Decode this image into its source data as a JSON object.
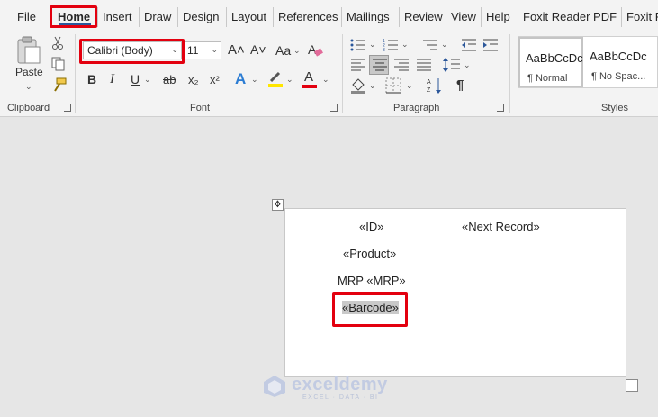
{
  "menu": {
    "tabs": [
      "File",
      "Home",
      "Insert",
      "Draw",
      "Design",
      "Layout",
      "References",
      "Mailings",
      "Review",
      "View",
      "Help",
      "Foxit Reader PDF",
      "Foxit P"
    ],
    "active": "Home"
  },
  "ribbon": {
    "clipboard": {
      "paste_label": "Paste",
      "group_label": "Clipboard"
    },
    "font": {
      "name": "Calibri (Body)",
      "size": "11",
      "grow_label": "A˄",
      "shrink_label": "A˅",
      "case_label": "Aa",
      "bold": "B",
      "italic": "I",
      "underline": "U",
      "strike": "ab",
      "subscript": "x₂",
      "superscript": "x²",
      "effects": "A",
      "font_color": "A",
      "group_label": "Font"
    },
    "paragraph": {
      "group_label": "Paragraph"
    },
    "styles": {
      "items": [
        {
          "sample": "AaBbCcDc",
          "name": "¶ Normal"
        },
        {
          "sample": "AaBbCcDc",
          "name": "¶ No Spac..."
        }
      ],
      "group_label": "Styles"
    }
  },
  "document": {
    "fields": {
      "id": "«ID»",
      "next_record": "«Next Record»",
      "product": "«Product»",
      "mrp": "MRP «MRP»",
      "barcode": "«Barcode»"
    }
  },
  "watermark": {
    "name": "exceldemy",
    "tagline": "EXCEL · DATA · BI"
  },
  "colors": {
    "accent": "#2b579a",
    "highlight_red": "#e3000f",
    "font_color_bar": "#e3000f",
    "highlighter": "#ffe600"
  }
}
